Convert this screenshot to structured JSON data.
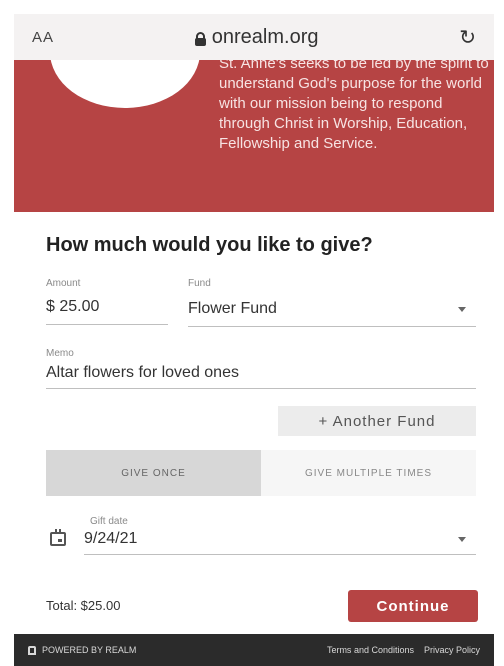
{
  "browser": {
    "text_size_label": "AA",
    "url": "onrealm.org",
    "reload_glyph": "↻"
  },
  "header": {
    "mission_text": "St. Anne's seeks to be led by the spirit to understand God's purpose for the world with our mission being to respond through Christ in Worship, Education, Fellowship and Service."
  },
  "form": {
    "question": "How much would you like to give?",
    "amount": {
      "label": "Amount",
      "value": "$ 25.00"
    },
    "fund": {
      "label": "Fund",
      "value": "Flower Fund"
    },
    "memo": {
      "label": "Memo",
      "value": "Altar flowers for loved ones"
    },
    "another_fund_label": "+ Another Fund",
    "frequency": {
      "options": [
        "GIVE ONCE",
        "GIVE MULTIPLE TIMES"
      ],
      "selected": "GIVE ONCE"
    },
    "gift_date": {
      "label": "Gift date",
      "value": "9/24/21"
    },
    "total": "Total: $25.00",
    "continue_label": "Continue"
  },
  "footer": {
    "powered_by": "POWERED BY REALM",
    "terms": "Terms and Conditions",
    "privacy": "Privacy Policy"
  },
  "colors": {
    "brand_red": "#b64444",
    "footer_dark": "#2b2b2b"
  }
}
